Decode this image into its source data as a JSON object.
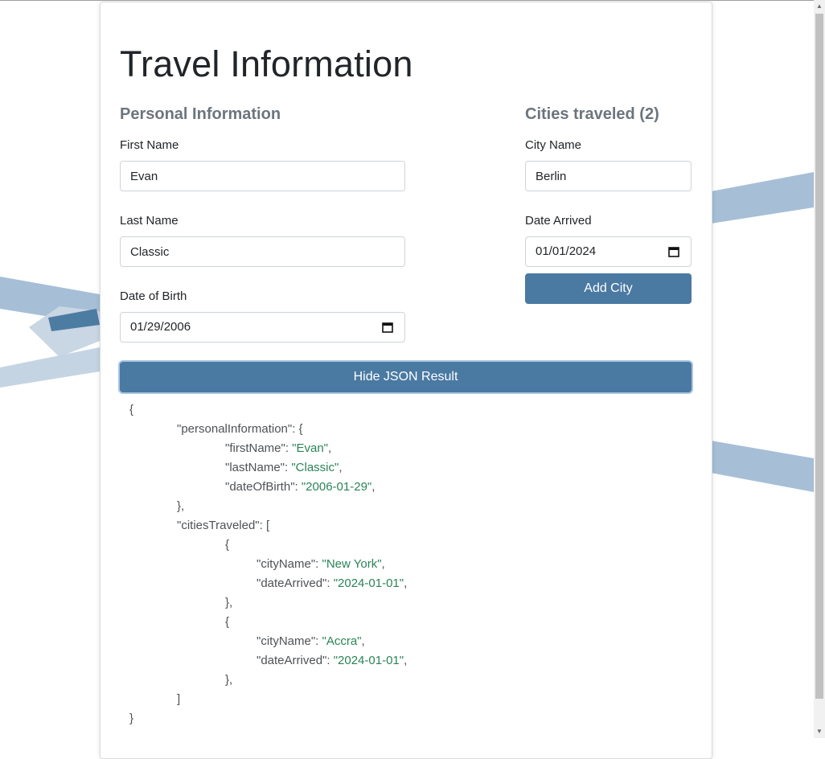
{
  "page": {
    "title": "Travel Information",
    "colors": {
      "accent": "#4a79a2",
      "string": "#2a8456",
      "muted": "#6c757d",
      "decor": "#a6bfd6"
    }
  },
  "personal": {
    "heading": "Personal Information",
    "first_name_label": "First Name",
    "first_name_value": "Evan",
    "last_name_label": "Last Name",
    "last_name_value": "Classic",
    "dob_label": "Date of Birth",
    "dob_value": "01/29/2006"
  },
  "cities": {
    "heading": "Cities traveled (2)",
    "city_name_label": "City Name",
    "city_name_value": "Berlin",
    "date_arrived_label": "Date Arrived",
    "date_arrived_value": "01/01/2024",
    "add_button": "Add City"
  },
  "toggle_json_button": "Hide JSON Result",
  "json_result": {
    "open": "{",
    "personal_key": "\"personalInformation\": {",
    "first_key": "\"firstName\": ",
    "first_val": "\"Evan\"",
    "last_key": "\"lastName\": ",
    "last_val": "\"Classic\"",
    "dob_key": "\"dateOfBirth\": ",
    "dob_val": "\"2006-01-29\"",
    "personal_close": "},",
    "cities_key": "\"citiesTraveled\": [",
    "item_open": "{",
    "city_key": "\"cityName\": ",
    "arrived_key": "\"dateArrived\": ",
    "item_close": "},",
    "comma": ",",
    "cities_close": "]",
    "close": "}",
    "items": [
      {
        "city": "\"New York\"",
        "arrived": "\"2024-01-01\""
      },
      {
        "city": "\"Accra\"",
        "arrived": "\"2024-01-01\""
      }
    ]
  }
}
